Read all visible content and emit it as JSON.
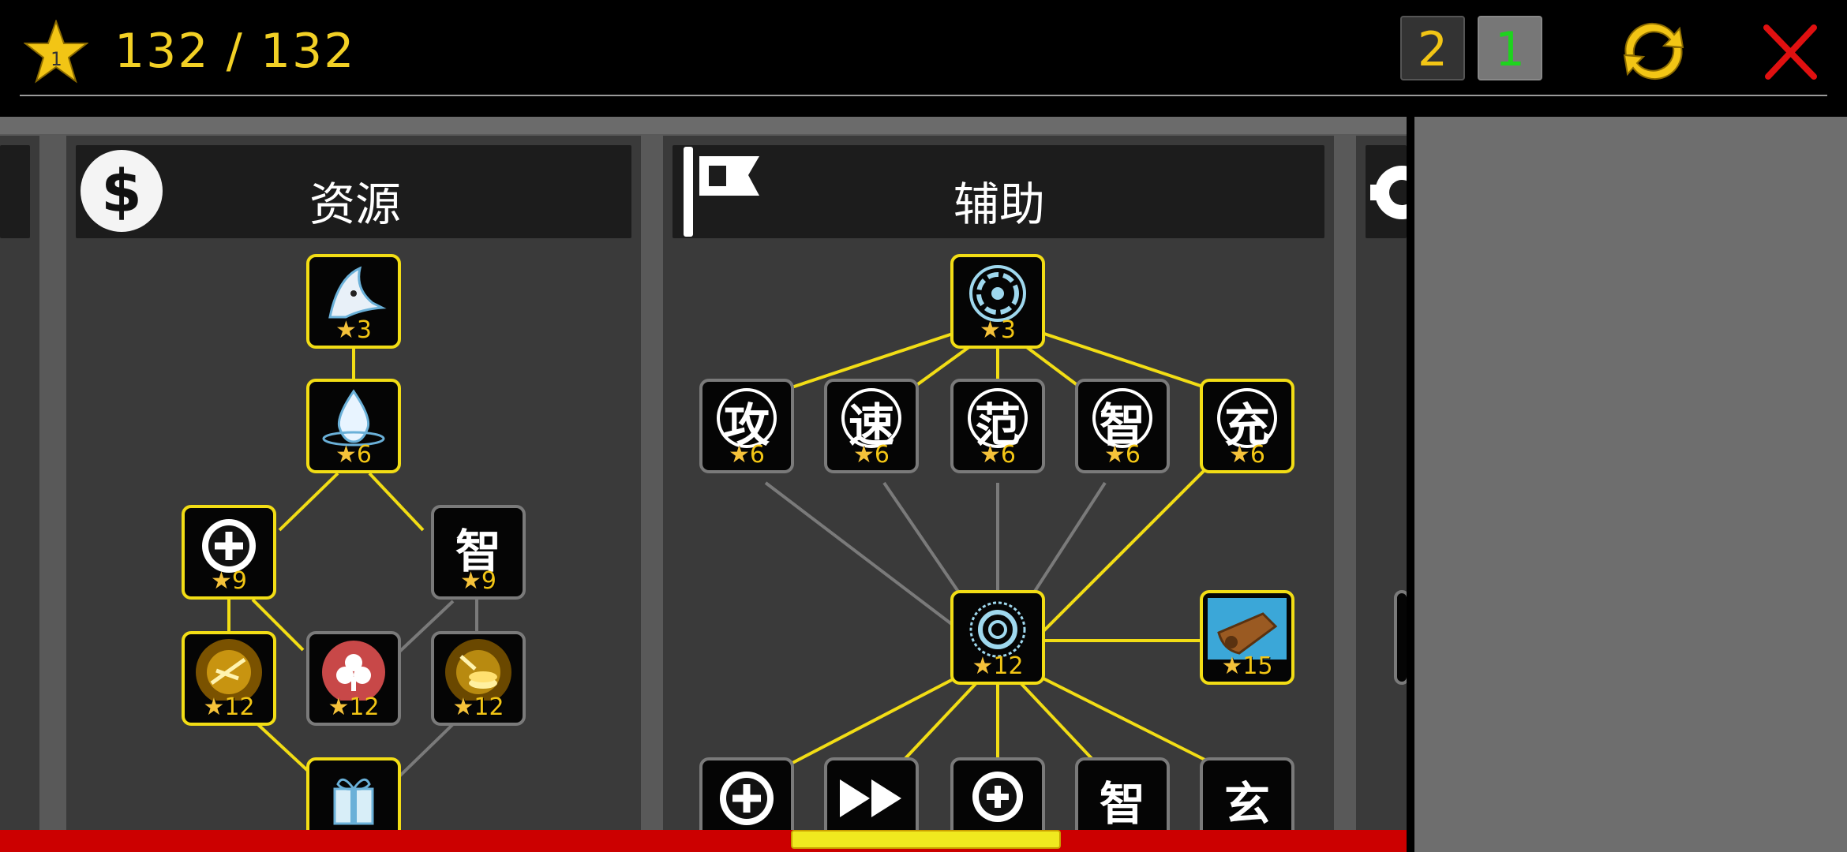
{
  "topbar": {
    "star_level": "1",
    "stars_count": "132 / 132",
    "page_buttons": [
      {
        "label": "2",
        "color": "#f2c515"
      },
      {
        "label": "1",
        "color": "#1ed31e"
      }
    ],
    "refresh_icon": "refresh-icon",
    "close_icon": "close-icon"
  },
  "columns": {
    "resources": {
      "title": "资源",
      "icon": "dollar-icon",
      "nodes": [
        {
          "id": "r1",
          "icon": "shark-icon",
          "cost": "3",
          "active": true
        },
        {
          "id": "r2",
          "icon": "water-drop-icon",
          "cost": "6",
          "active": true
        },
        {
          "id": "r3",
          "icon": "plus-circle-icon",
          "cost": "9",
          "active": true
        },
        {
          "id": "r4",
          "glyph": "智",
          "cost": "9",
          "active": false
        },
        {
          "id": "r5",
          "icon": "gold-scroll-icon",
          "cost": "12",
          "active": true
        },
        {
          "id": "r6",
          "icon": "clover-icon",
          "cost": "12",
          "active": false
        },
        {
          "id": "r7",
          "icon": "gold-coins-icon",
          "cost": "12",
          "active": false
        },
        {
          "id": "r8",
          "icon": "gift-box-icon",
          "cost": "",
          "active": true
        }
      ]
    },
    "support": {
      "title": "辅助",
      "icon": "flag-icon",
      "nodes": [
        {
          "id": "s1",
          "icon": "shield-wheel-icon",
          "cost": "3",
          "active": true
        },
        {
          "id": "s2",
          "glyph": "攻",
          "cost": "6",
          "active": false
        },
        {
          "id": "s3",
          "glyph": "速",
          "cost": "6",
          "active": false
        },
        {
          "id": "s4",
          "glyph": "范",
          "cost": "6",
          "active": false
        },
        {
          "id": "s5",
          "glyph": "智",
          "cost": "6",
          "active": false
        },
        {
          "id": "s6",
          "glyph": "充",
          "cost": "6",
          "active": true
        },
        {
          "id": "s7",
          "icon": "target-wheel-icon",
          "cost": "12",
          "active": true
        },
        {
          "id": "s8",
          "icon": "whistle-icon",
          "cost": "15",
          "active": true
        },
        {
          "id": "s9",
          "icon": "plus-circle-icon",
          "cost": "",
          "active": false
        },
        {
          "id": "s10",
          "icon": "fast-forward-icon",
          "cost": "",
          "active": false
        },
        {
          "id": "s11",
          "icon": "magnify-plus-icon",
          "cost": "",
          "active": false
        },
        {
          "id": "s12",
          "glyph": "智",
          "cost": "",
          "active": false
        },
        {
          "id": "s13",
          "glyph": "玄",
          "cost": "",
          "active": false
        }
      ]
    }
  },
  "colors": {
    "accent_yellow": "#f2dd15",
    "inactive_gray": "#7a7a7a",
    "close_red": "#e01010",
    "bar_red": "#cc0000"
  }
}
